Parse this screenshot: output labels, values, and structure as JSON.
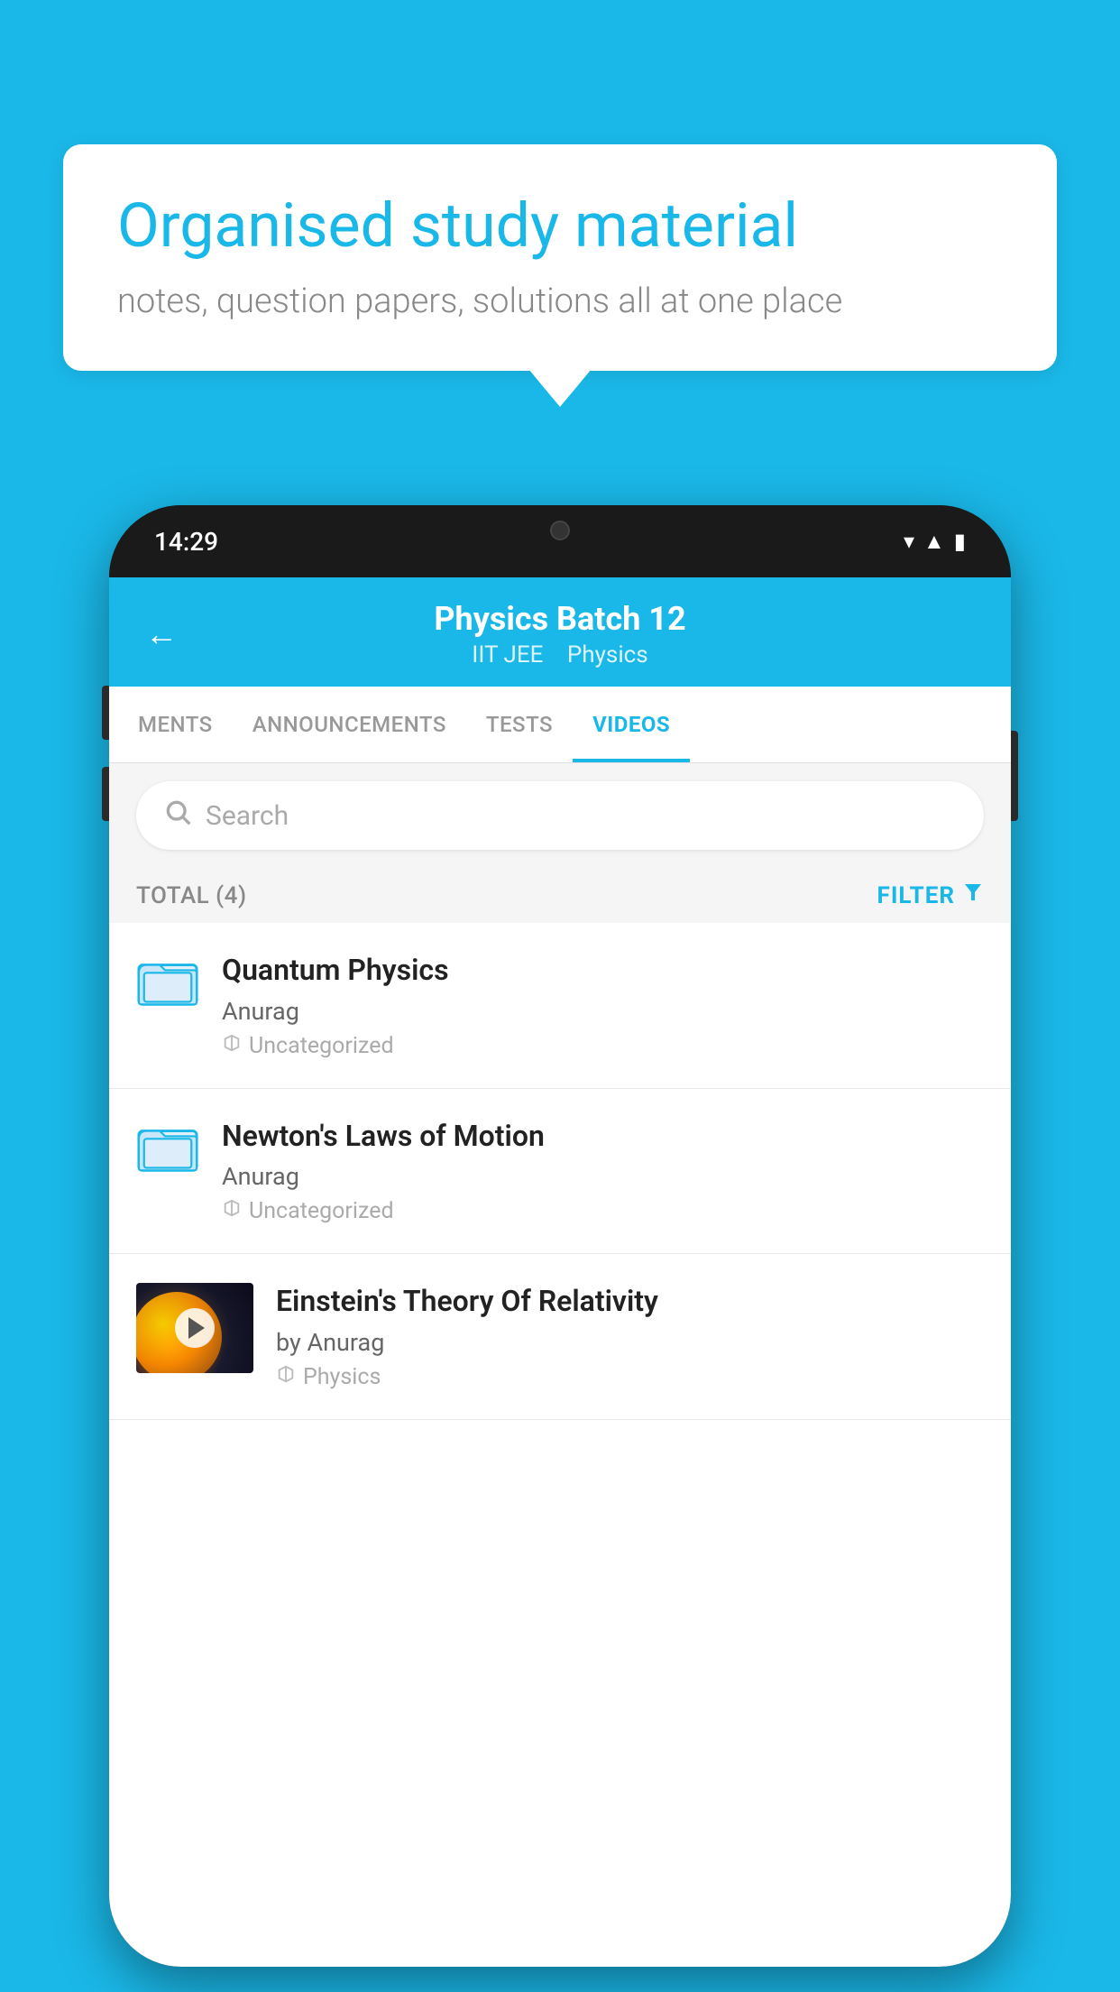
{
  "background_color": "#1AB8E8",
  "speech_bubble": {
    "title": "Organised study material",
    "subtitle": "notes, question papers, solutions all at one place"
  },
  "phone": {
    "status_bar": {
      "time": "14:29"
    },
    "header": {
      "back_label": "←",
      "title": "Physics Batch 12",
      "subtitle_part1": "IIT JEE",
      "subtitle_part2": "Physics"
    },
    "tabs": [
      {
        "label": "MENTS",
        "active": false
      },
      {
        "label": "ANNOUNCEMENTS",
        "active": false
      },
      {
        "label": "TESTS",
        "active": false
      },
      {
        "label": "VIDEOS",
        "active": true
      }
    ],
    "search": {
      "placeholder": "Search"
    },
    "filter_bar": {
      "total_label": "TOTAL (4)",
      "filter_label": "FILTER"
    },
    "videos": [
      {
        "title": "Quantum Physics",
        "author": "Anurag",
        "tag": "Uncategorized",
        "has_thumbnail": false,
        "thumbnail_type": "folder"
      },
      {
        "title": "Newton's Laws of Motion",
        "author": "Anurag",
        "tag": "Uncategorized",
        "has_thumbnail": false,
        "thumbnail_type": "folder"
      },
      {
        "title": "Einstein's Theory Of Relativity",
        "author": "by Anurag",
        "tag": "Physics",
        "has_thumbnail": true,
        "thumbnail_type": "video"
      }
    ]
  }
}
